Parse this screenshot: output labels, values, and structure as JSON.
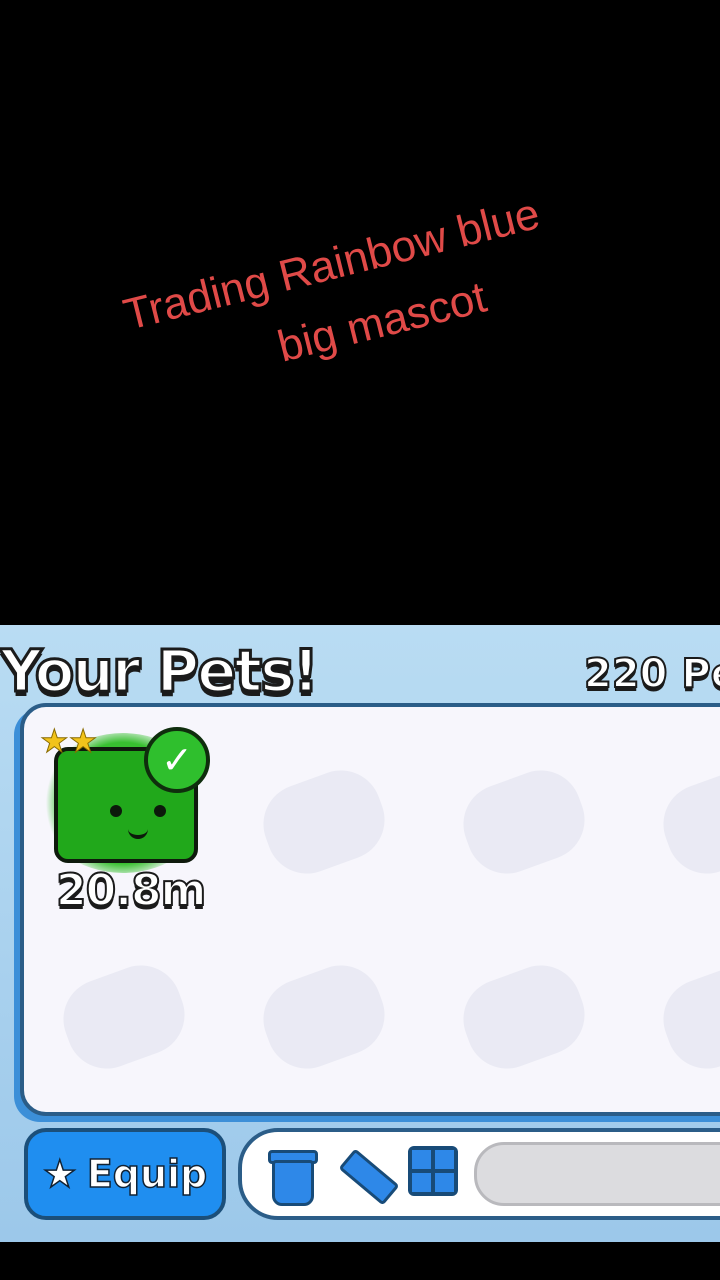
{
  "overlay_caption": {
    "line1": "Trading Rainbow blue",
    "line2": "big mascot"
  },
  "inventory": {
    "title": "Your Pets!",
    "count_text": "220 Pe",
    "pets": [
      {
        "value_label": "20.8m",
        "equipped": true,
        "stars": 2
      }
    ],
    "equip_label": "Equip"
  },
  "colors": {
    "caption": "#e04a48",
    "panel_bg": "#a9d2ef",
    "equip_button": "#1f8ef0",
    "pet_green": "#21a81b"
  },
  "icons": [
    "star-icon",
    "trash-icon",
    "pencil-icon",
    "grid-icon",
    "checkmark-icon"
  ]
}
